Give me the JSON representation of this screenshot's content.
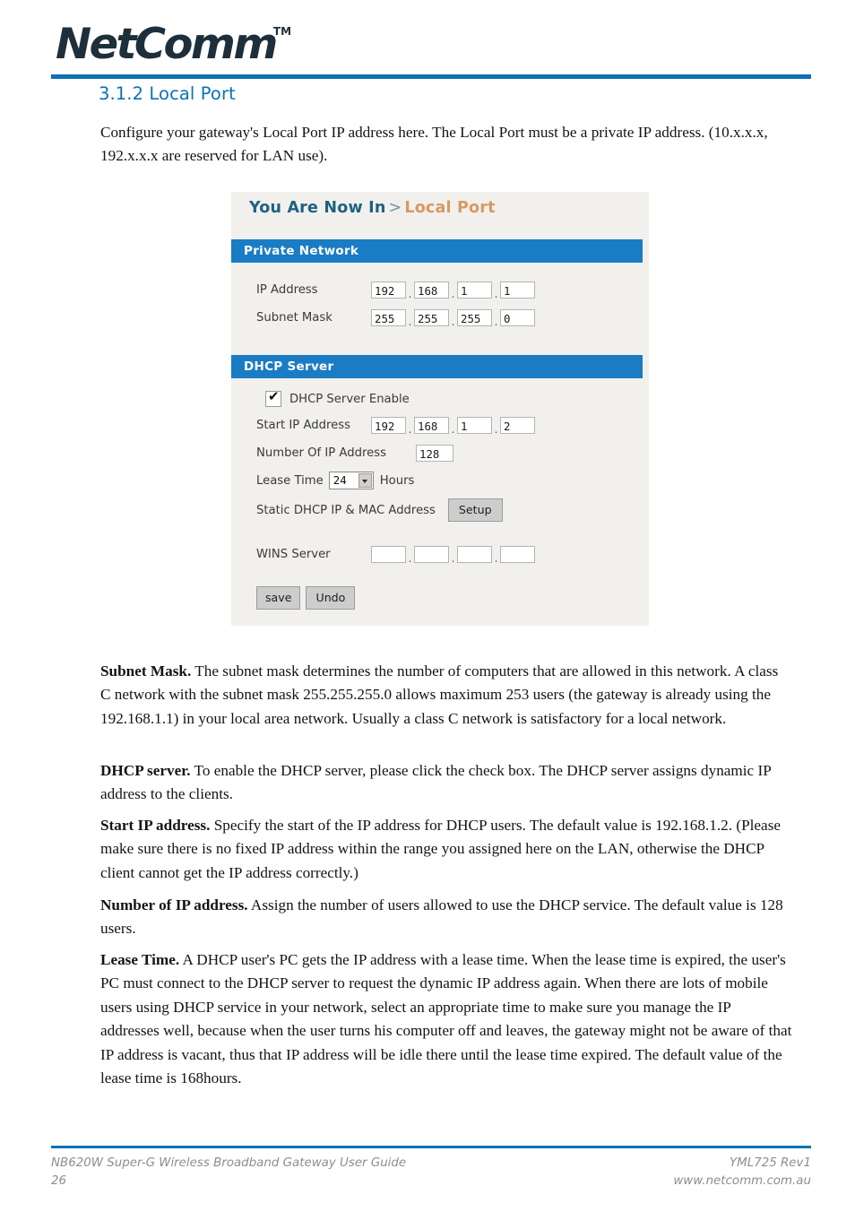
{
  "brand": {
    "logo_text": "NetComm",
    "trademark": "TM"
  },
  "page_title": "3.1.2 Local Port",
  "intro_paragraph": "Configure your gateway's Local Port IP address here. The Local Port must be a private IP address. (10.x.x.x, 192.x.x.x are reserved for LAN use).",
  "router_ui": {
    "breadcrumb": {
      "here_label": "You Are Now In",
      "separator": ">",
      "current_page": "Local Port"
    },
    "private_network": {
      "title": "Private Network",
      "ip_address": {
        "label": "IP Address",
        "octets": [
          "192",
          "168",
          "1",
          "1"
        ]
      },
      "subnet_mask": {
        "label": "Subnet Mask",
        "octets": [
          "255",
          "255",
          "255",
          "0"
        ]
      }
    },
    "dhcp_server": {
      "title": "DHCP Server",
      "enable": {
        "label": "DHCP Server Enable",
        "checked": true,
        "tick_glyph": "✔"
      },
      "start_ip_address": {
        "label": "Start IP Address",
        "octets": [
          "192",
          "168",
          "1",
          "2"
        ]
      },
      "number_of_ip_address": {
        "label": "Number Of IP Address",
        "value": "128"
      },
      "lease_time": {
        "label": "Lease Time",
        "value": "24",
        "unit_label": "Hours"
      },
      "static_dhcp": {
        "label": "Static DHCP IP & MAC Address",
        "button_label": "Setup"
      },
      "wins_server": {
        "label": "WINS Server",
        "octets": [
          "",
          "",
          "",
          ""
        ]
      }
    },
    "actions": {
      "save_label": "save",
      "undo_label": "Undo"
    }
  },
  "body_paragraphs": {
    "subnet_mask": {
      "term": "Subnet Mask.",
      "text": " The subnet mask determines the number of computers that are allowed in this network. A class C network with the subnet mask 255.255.255.0 allows maximum 253 users (the gateway is already using the 192.168.1.1) in your local area network. Usually a class C network is satisfactory for a local network."
    },
    "dhcp_server": {
      "term": "DHCP server.",
      "text": " To enable the DHCP server, please click the check box. The DHCP server assigns dynamic IP address to the clients."
    },
    "start_ip_address": {
      "term": "Start IP address.",
      "text": " Specify the start of the IP address for DHCP users. The default value is 192.168.1.2. (Please make sure there is no fixed IP address within the range you assigned here on the LAN, otherwise the DHCP client cannot get the IP address correctly.)"
    },
    "number_of_ip_address": {
      "term": "Number of IP address.",
      "text": " Assign the number of users allowed to use the DHCP service. The default value is 128 users."
    },
    "lease_time": {
      "term": "Lease Time.",
      "text": " A DHCP user's PC gets the IP address with a lease time. When the lease time is expired, the user's PC must connect to the DHCP server to request the dynamic IP address again. When there are lots of mobile users using DHCP service in your network, select an appropriate time to make sure you manage the IP addresses well, because when the user turns his computer off and leaves, the gateway might not be aware of that IP address is vacant, thus that IP address will be idle there until the lease time expired. The default value of the lease time is 168hours."
    }
  },
  "footer": {
    "guide_title": "NB620W Super-G Wireless Broadband  Gateway User Guide",
    "page_number": "26",
    "doc_code": "YML725 Rev1",
    "website": "www.netcomm.com.au"
  },
  "colors": {
    "brand_blue": "#0b72b5",
    "panel_blue": "#1a7cc4",
    "breadcrumb_here": "#1f6183",
    "breadcrumb_page": "#d79a63",
    "logo_navy": "#1e2f3c",
    "footer_grey": "#8d8d8d"
  }
}
